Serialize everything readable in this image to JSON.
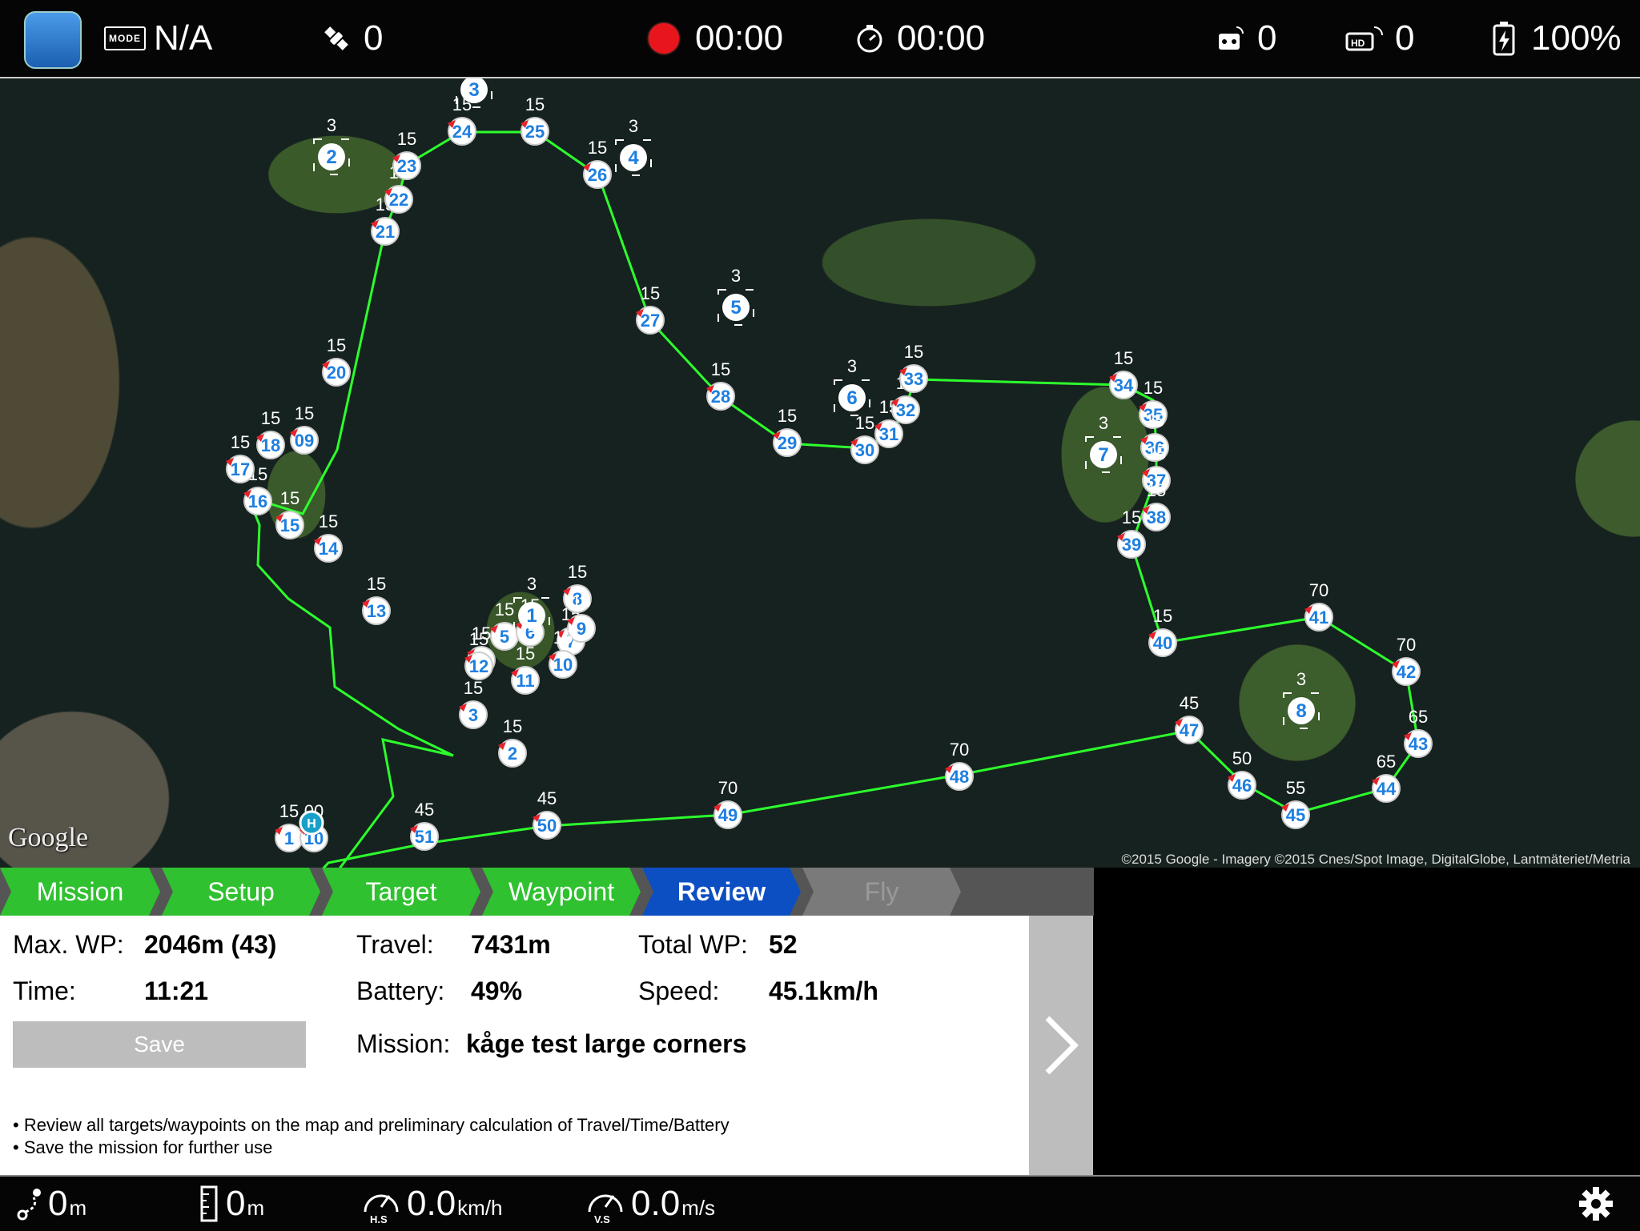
{
  "topbar": {
    "mode_badge": "MODE",
    "mode_value": "N/A",
    "satellites": "0",
    "record_time": "00:00",
    "flight_time": "00:00",
    "rc_signal": "0",
    "hd_signal": "0",
    "battery": "100%"
  },
  "map": {
    "google_logo": "Google",
    "attribution": "©2015 Google - Imagery ©2015 Cnes/Spot Image, DigitalGlobe, Lantmäteriet/Metria",
    "home_label": "H"
  },
  "steps": [
    "Mission",
    "Setup",
    "Target",
    "Waypoint",
    "Review",
    "Fly"
  ],
  "colors": {
    "done": "#2fc12f",
    "active": "#0b4fc2",
    "disabled": "#7a7a7a",
    "route": "#2dff2d"
  },
  "review": {
    "max_wp_label": "Max. WP:",
    "max_wp_value": "2046m (43)",
    "time_label": "Time:",
    "time_value": "11:21",
    "travel_label": "Travel:",
    "travel_value": "7431m",
    "battery_label": "Battery:",
    "battery_value": "49%",
    "total_wp_label": "Total WP:",
    "total_wp_value": "52",
    "speed_label": "Speed:",
    "speed_value": "45.1km/h",
    "mission_label": "Mission:",
    "mission_value": "kåge test large corners",
    "save_label": "Save",
    "note1": "• Review all targets/waypoints on the map and preliminary calculation of Travel/Time/Battery",
    "note2": "• Save the mission for further use"
  },
  "bottombar": {
    "distance_value": "0",
    "distance_unit": "m",
    "altitude_value": "0",
    "altitude_unit": "m",
    "hs_label": "H.S",
    "hs_value": "0.0",
    "hs_unit": "km/h",
    "vs_label": "V.S",
    "vs_value": "0.0",
    "vs_unit": "m/s"
  }
}
